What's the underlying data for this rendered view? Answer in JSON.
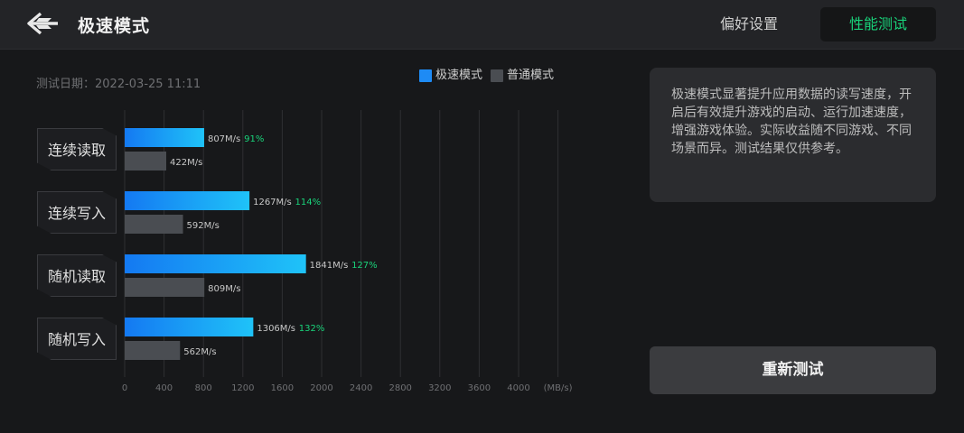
{
  "header": {
    "title": "极速模式",
    "tabs": [
      {
        "label": "偏好设置",
        "selected": false
      },
      {
        "label": "性能测试",
        "selected": true
      }
    ]
  },
  "test_date": "测试日期：2022-03-25 11:11",
  "legend": [
    {
      "label": "极速模式",
      "color": "#1e8bf5"
    },
    {
      "label": "普通模式",
      "color": "#4a4d52"
    }
  ],
  "description": "极速模式显著提升应用数据的读写速度，开启后有效提升游戏的启动、运行加速速度，增强游戏体验。实际收益随不同游戏、不同场景而异。测试结果仅供参考。",
  "retest_button": "重新测试",
  "colors": {
    "accent": "#19d27a",
    "fast_start": "#1479f2",
    "fast_end": "#1fc3f8",
    "normal": "#4a4d52"
  },
  "chart_data": {
    "type": "bar",
    "orientation": "horizontal",
    "categories": [
      "连续读取",
      "连续写入",
      "随机读取",
      "随机写入"
    ],
    "series": [
      {
        "name": "极速模式",
        "values": [
          807,
          1267,
          1841,
          1306
        ],
        "labels": [
          "807M/s",
          "1267M/s",
          "1841M/s",
          "1306M/s"
        ]
      },
      {
        "name": "普通模式",
        "values": [
          422,
          592,
          809,
          562
        ],
        "labels": [
          "422M/s",
          "592M/s",
          "809M/s",
          "562M/s"
        ]
      }
    ],
    "improvements": [
      "91%",
      "114%",
      "127%",
      "132%"
    ],
    "x_ticks": [
      "0",
      "400",
      "800",
      "1200",
      "1600",
      "2000",
      "2400",
      "2800",
      "3200",
      "3600",
      "4000"
    ],
    "x_unit": "(MB/s)",
    "xlim": [
      0,
      4400
    ],
    "grid": true
  }
}
